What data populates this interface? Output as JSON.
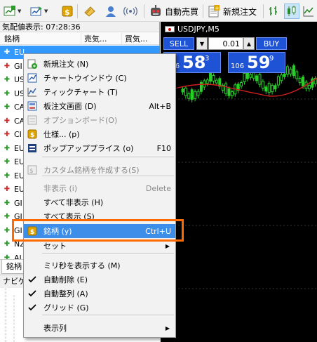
{
  "toolbar": {
    "autotrade_label": "自動売買",
    "new_order_label": "新規注文"
  },
  "market_watch": {
    "title": "気配値表示: 07:28:36",
    "col_symbol": "銘柄",
    "col_bid": "売気...",
    "col_ask": "買気...",
    "rows": [
      {
        "dir": "up",
        "symbol": "EU"
      },
      {
        "dir": "down",
        "symbol": "GI"
      },
      {
        "dir": "up",
        "symbol": "US"
      },
      {
        "dir": "up",
        "symbol": "US"
      },
      {
        "dir": "up",
        "symbol": "CA"
      },
      {
        "dir": "down",
        "symbol": "CA"
      },
      {
        "dir": "down",
        "symbol": "CI"
      },
      {
        "dir": "up",
        "symbol": "EU"
      },
      {
        "dir": "up",
        "symbol": "EU"
      },
      {
        "dir": "up",
        "symbol": "EU"
      },
      {
        "dir": "down",
        "symbol": "EU"
      },
      {
        "dir": "up",
        "symbol": "GI"
      },
      {
        "dir": "up",
        "symbol": "GI"
      },
      {
        "dir": "up",
        "symbol": "GI"
      },
      {
        "dir": "up",
        "symbol": "NZ"
      },
      {
        "dir": "up",
        "symbol": "AL"
      }
    ],
    "tab_label": "銘柄",
    "navigator_title": "ナビゲ"
  },
  "chart": {
    "symbol_title": "USDJPY,M5",
    "sell_label": "SELL",
    "buy_label": "BUY",
    "lot_value": "0.01",
    "bid_small": "106",
    "bid_big": "58",
    "bid_sup": "3",
    "ask_small": "106",
    "ask_big": "59",
    "ask_sup": "9"
  },
  "context_menu": {
    "items": [
      {
        "label": "新規注文 (N)",
        "shortcut": "",
        "icon": "new-order-icon",
        "disabled": false
      },
      {
        "label": "チャートウインドウ (C)",
        "shortcut": "",
        "icon": "chart-window-icon",
        "disabled": false
      },
      {
        "label": "ティックチャート (T)",
        "shortcut": "",
        "icon": "tick-chart-icon",
        "disabled": false
      },
      {
        "label": "板注文画面 (D)",
        "shortcut": "Alt+B",
        "icon": "depth-of-market-icon",
        "disabled": false
      },
      {
        "label": "オプションボード(O)",
        "shortcut": "",
        "icon": "option-board-icon",
        "disabled": true
      },
      {
        "label": "仕様... (p)",
        "shortcut": "",
        "icon": "specification-icon",
        "disabled": false
      },
      {
        "label": "ポップアッププライス (o)",
        "shortcut": "F10",
        "icon": "popup-price-icon",
        "disabled": false
      },
      {
        "label": "カスタム銘柄を作成する(S)",
        "shortcut": "",
        "icon": "custom-symbol-icon",
        "disabled": true
      },
      {
        "label": "非表示 (i)",
        "shortcut": "Delete",
        "icon": "",
        "disabled": true
      },
      {
        "label": "すべて非表示 (H)",
        "shortcut": "",
        "icon": "",
        "disabled": false
      },
      {
        "label": "すべて表示 (S)",
        "shortcut": "",
        "icon": "",
        "disabled": false
      },
      {
        "label": "銘柄 (y)",
        "shortcut": "Ctrl+U",
        "icon": "symbols-icon",
        "disabled": false
      },
      {
        "label": "セット",
        "shortcut": "",
        "icon": "",
        "disabled": false
      },
      {
        "label": "ミリ秒を表示する (M)",
        "shortcut": "",
        "icon": "",
        "disabled": false
      },
      {
        "label": "自動削除 (E)",
        "shortcut": "",
        "icon": "check-icon",
        "disabled": false
      },
      {
        "label": "自動整列 (A)",
        "shortcut": "",
        "icon": "check-icon",
        "disabled": false
      },
      {
        "label": "グリッド (G)",
        "shortcut": "",
        "icon": "check-icon",
        "disabled": false
      },
      {
        "label": "表示列",
        "shortcut": "",
        "icon": "",
        "disabled": false
      }
    ]
  },
  "colors": {
    "highlight": "#3d8ee8",
    "callout": "#ff6a00",
    "trade_button": "#1f53d6"
  }
}
